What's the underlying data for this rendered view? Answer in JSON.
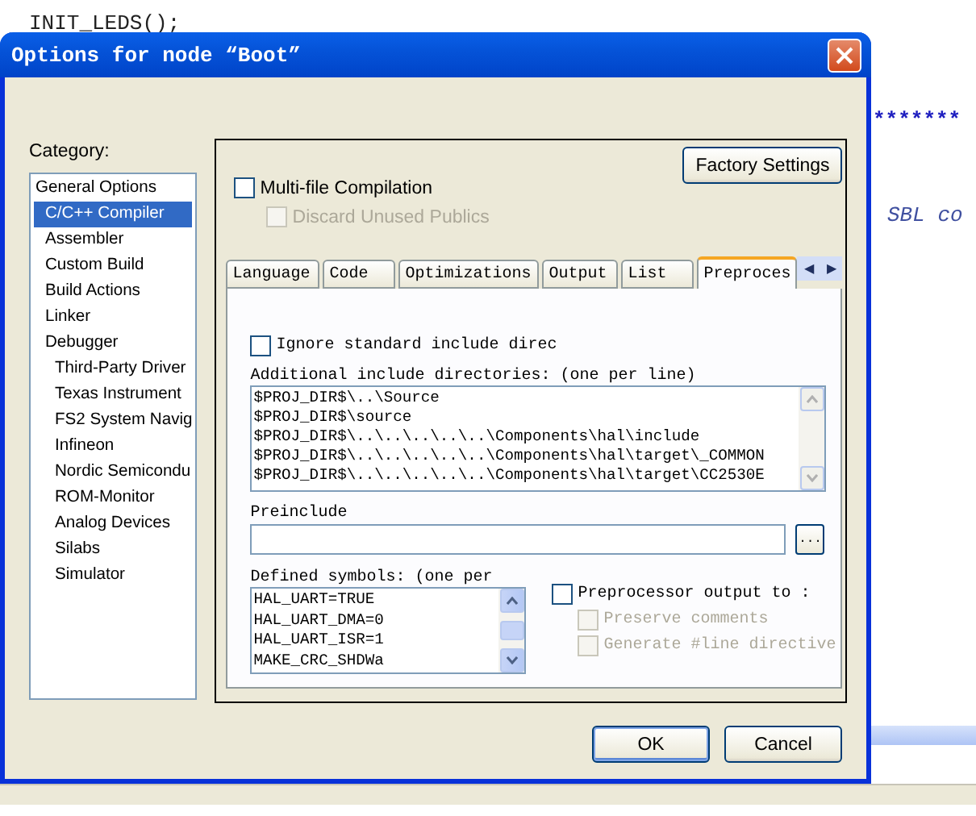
{
  "editor": {
    "lines": [
      {
        "kind": "code",
        "text": "INIT_LEDS();"
      },
      {
        "kind": "comment",
        "text": "*******"
      },
      {
        "kind": "comment-italic",
        "text": "SBL co"
      }
    ]
  },
  "window": {
    "title": "Options for node “Boot”"
  },
  "category": {
    "label": "Category:",
    "items": [
      {
        "label": "General Options",
        "selected": false
      },
      {
        "label": "C/C++ Compiler",
        "selected": true
      },
      {
        "label": "Assembler",
        "selected": false
      },
      {
        "label": "Custom Build",
        "selected": false
      },
      {
        "label": "Build Actions",
        "selected": false
      },
      {
        "label": "Linker",
        "selected": false
      },
      {
        "label": "Debugger",
        "selected": false,
        "children": [
          {
            "label": "Third-Party Driver",
            "selected": false
          },
          {
            "label": "Texas Instrument",
            "selected": false
          },
          {
            "label": "FS2 System Navig",
            "selected": false
          },
          {
            "label": "Infineon",
            "selected": false
          },
          {
            "label": "Nordic Semicondu",
            "selected": false
          },
          {
            "label": "ROM-Monitor",
            "selected": false
          },
          {
            "label": "Analog Devices",
            "selected": false
          },
          {
            "label": "Silabs",
            "selected": false
          },
          {
            "label": "Simulator",
            "selected": false
          }
        ]
      }
    ]
  },
  "factory_button": "Factory Settings",
  "options": [
    {
      "label": "Multi-file Compilation",
      "checked": false,
      "disabled": false
    },
    {
      "label": "Discard Unused Publics",
      "checked": false,
      "disabled": true
    }
  ],
  "tabs": [
    {
      "label": "Language",
      "selected": false
    },
    {
      "label": "Code",
      "selected": false
    },
    {
      "label": "Optimizations",
      "selected": false
    },
    {
      "label": "Output",
      "selected": false
    },
    {
      "label": "List",
      "selected": false
    },
    {
      "label": "Preproces",
      "selected": true
    }
  ],
  "tab_arrows": [
    "◀",
    "▶"
  ],
  "preprocessor": {
    "ignore": {
      "label": "Ignore standard include direc",
      "checked": false
    },
    "include_label": "Additional include directories: (one per line)",
    "include_lines": [
      "$PROJ_DIR$\\..\\Source",
      "$PROJ_DIR$\\source",
      "$PROJ_DIR$\\..\\..\\..\\..\\..\\Components\\hal\\include",
      "$PROJ_DIR$\\..\\..\\..\\..\\..\\Components\\hal\\target\\_COMMON",
      "$PROJ_DIR$\\..\\..\\..\\..\\..\\Components\\hal\\target\\CC2530E"
    ],
    "preinclude_label": "Preinclude",
    "browse": "...",
    "defined_label": "Defined symbols: (one per",
    "defined_lines": [
      "HAL_UART=TRUE",
      "HAL_UART_DMA=0",
      "HAL_UART_ISR=1",
      "MAKE_CRC_SHDWa"
    ],
    "output": [
      {
        "label": "Preprocessor output to :",
        "checked": false,
        "disabled": false
      },
      {
        "label": "Preserve comments",
        "checked": false,
        "disabled": true
      },
      {
        "label": "Generate #line directive",
        "checked": false,
        "disabled": true
      }
    ]
  },
  "buttons": [
    {
      "label": "OK",
      "default": true
    },
    {
      "label": "Cancel",
      "default": false
    }
  ]
}
